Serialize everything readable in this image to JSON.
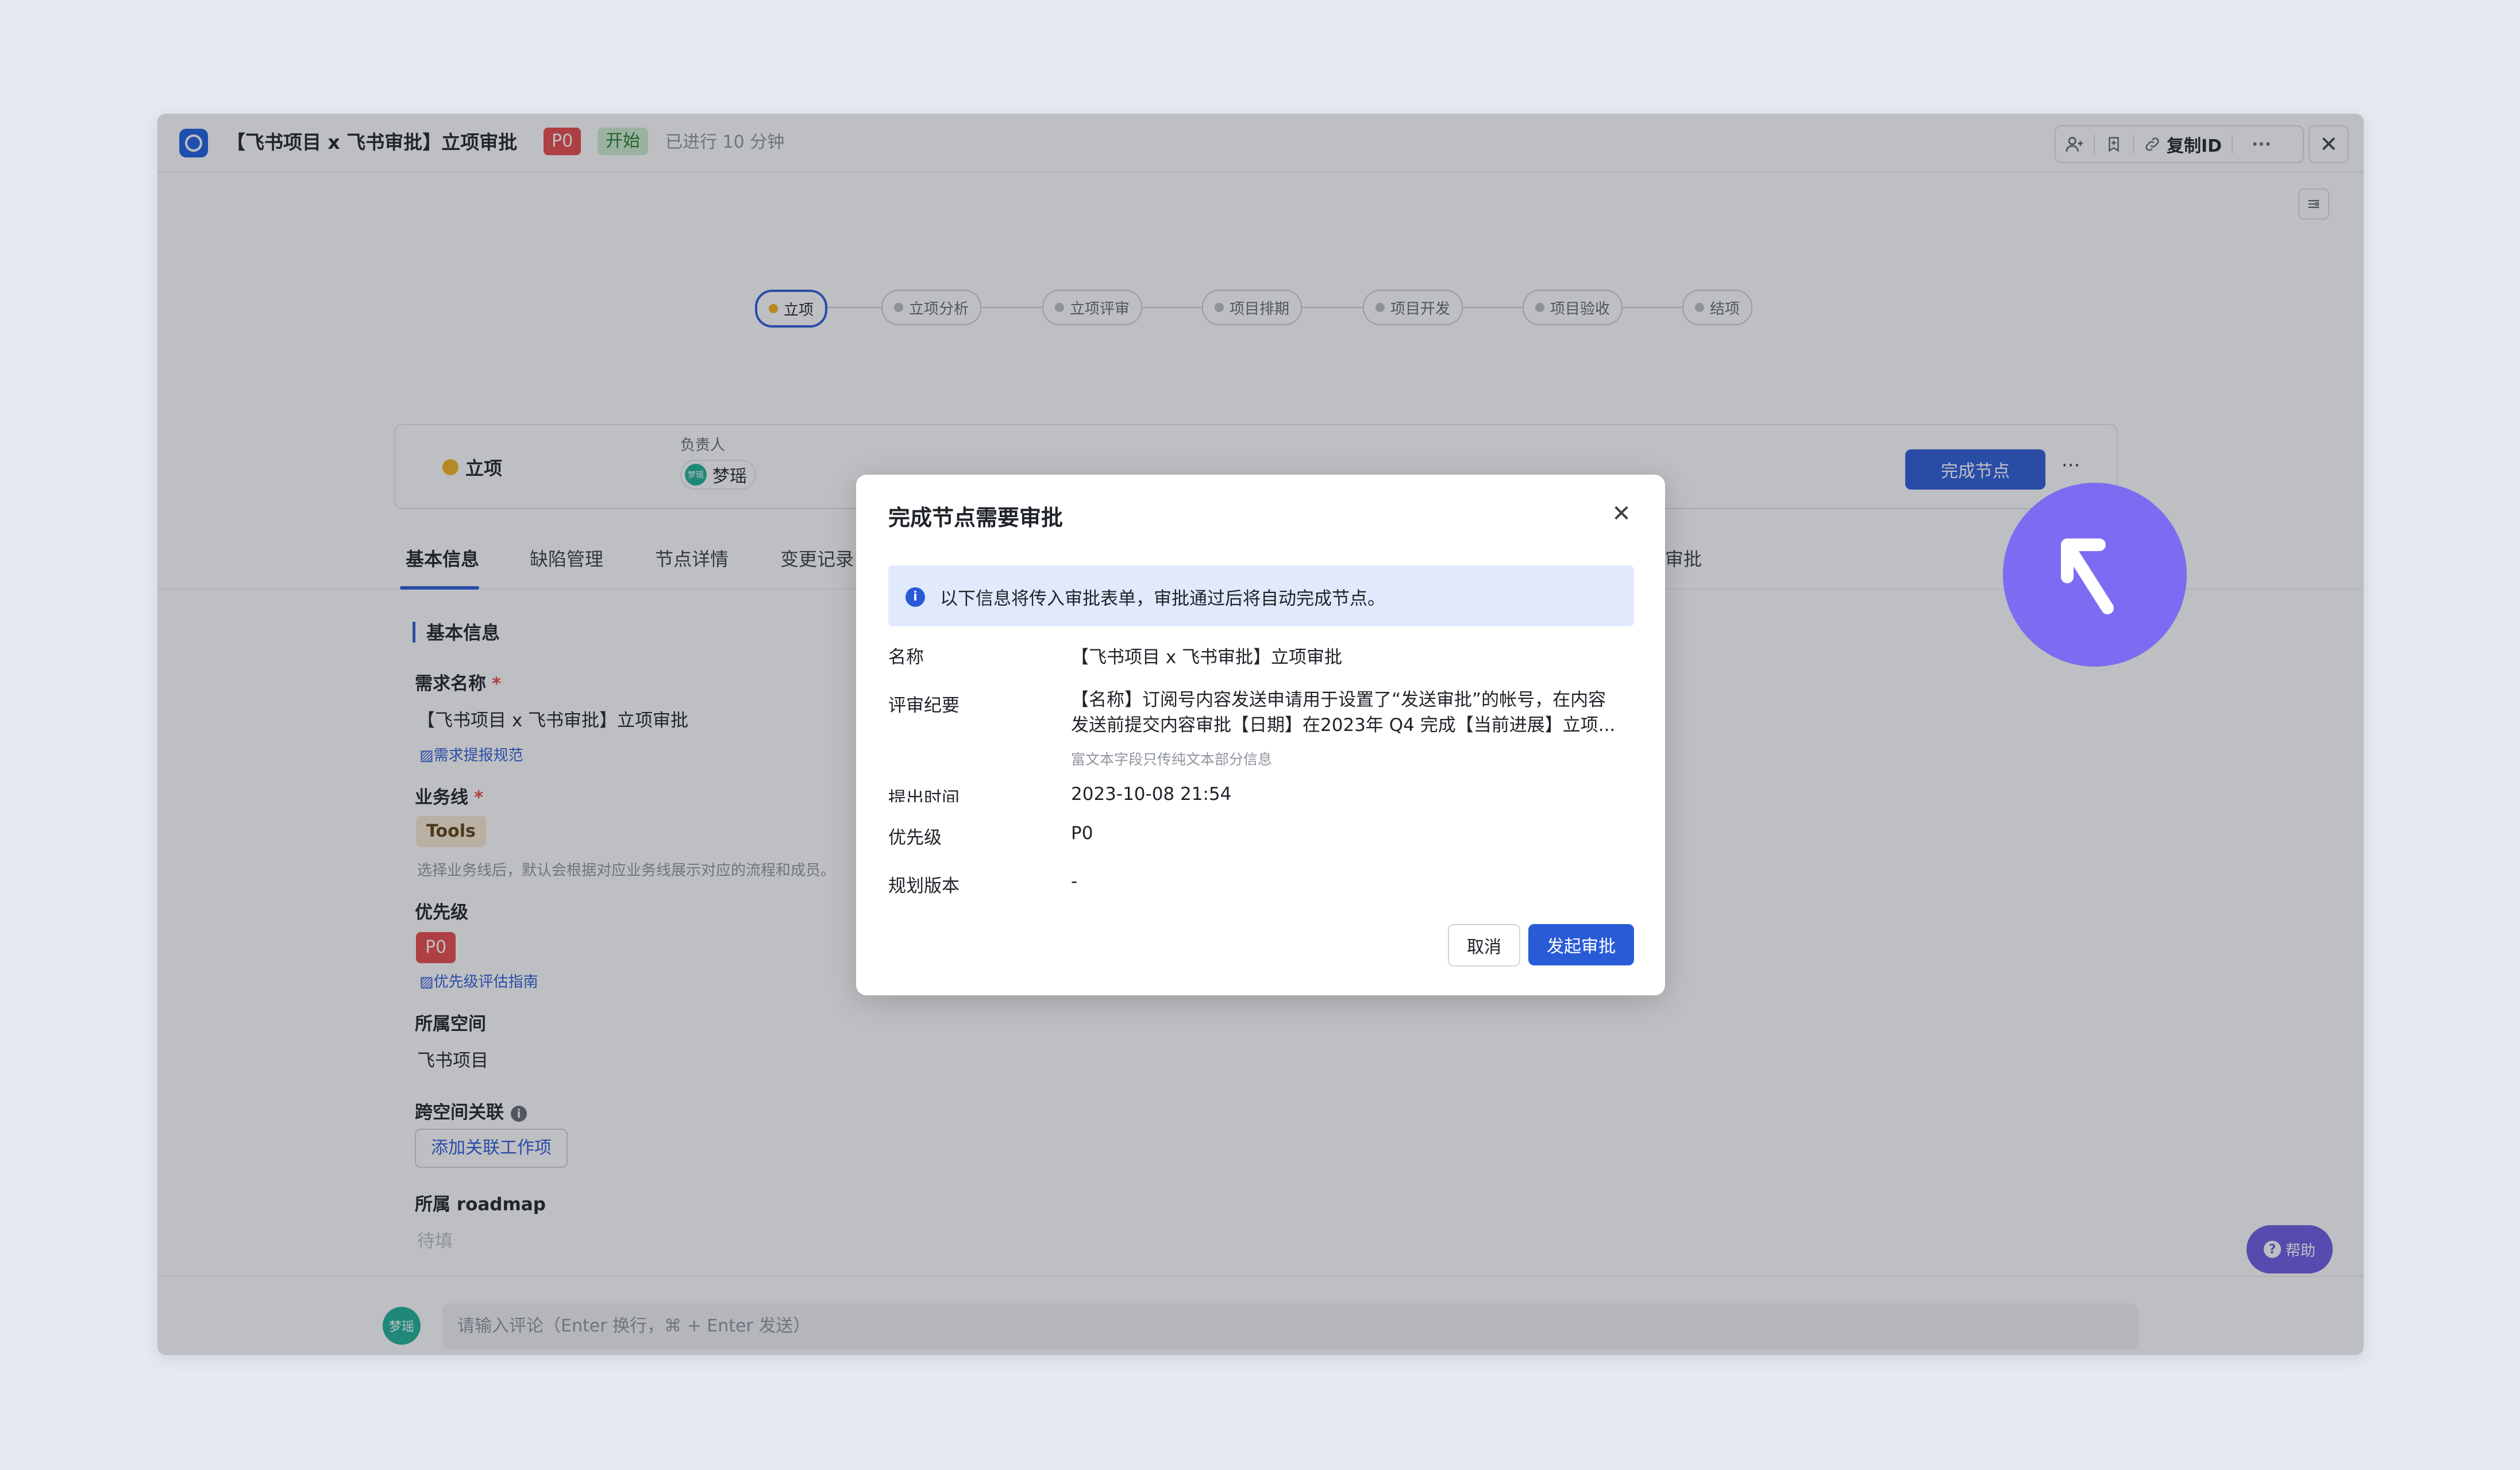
{
  "window": {
    "title": "【飞书项目 x 飞书审批】立项审批",
    "priority_tag": "P0",
    "status_tag": "开始",
    "elapsed": "已进行 10 分钟",
    "copy_id_label": "复制ID",
    "more_label": "···",
    "close_label": "✕"
  },
  "workflow": {
    "nodes": [
      "立项",
      "立项分析",
      "立项评审",
      "项目排期",
      "项目开发",
      "项目验收",
      "结项"
    ],
    "active_index": 0
  },
  "node_card": {
    "status_label": "立项",
    "owner_label": "负责人",
    "owner_name": "梦瑶",
    "owner_avatar_text": "梦瑶",
    "complete_button": "完成节点",
    "more_label": "···"
  },
  "tabs": [
    "基本信息",
    "缺陷管理",
    "节点详情",
    "变更记录",
    "审批"
  ],
  "basic_info": {
    "section_title": "基本信息",
    "req_name_label": "需求名称",
    "req_name_value": "【飞书项目 x 飞书审批】立项审批",
    "req_name_hint": "需求提报规范",
    "biz_line_label": "业务线",
    "biz_line_value": "Tools",
    "biz_line_hint": "选择业务线后，默认会根据对应业务线展示对应的流程和成员。",
    "priority_label": "优先级",
    "priority_value": "P0",
    "priority_hint": "优先级评估指南",
    "space_label": "所属空间",
    "space_value": "飞书项目",
    "cross_label": "跨空间关联",
    "add_link_button": "添加关联工作项",
    "roadmap_label": "所属 roadmap",
    "roadmap_value": "待填",
    "required_mark": "*"
  },
  "comment": {
    "avatar_text": "梦瑶",
    "placeholder": "请输入评论（Enter 换行，⌘ + Enter 发送）"
  },
  "help": {
    "label": "帮助"
  },
  "modal": {
    "title": "完成节点需要审批",
    "close": "✕",
    "banner": "以下信息将传入审批表单，审批通过后将自动完成节点。",
    "fields": {
      "name_label": "名称",
      "name_value": "【飞书项目 x 飞书审批】立项审批",
      "summary_label": "评审纪要",
      "summary_line1": "【名称】订阅号内容发送申请用于设置了“发送审批”的帐号，在内容",
      "summary_line2": "发送前提交内容审批【日期】在2023年 Q4 完成【当前进展】立项...",
      "summary_note": "富文本字段只传纯文本部分信息",
      "time_label": "提出时间",
      "time_value": "2023-10-08 21:54",
      "priority_label": "优先级",
      "priority_value": "P0",
      "version_label": "规划版本",
      "version_value": "-"
    },
    "cancel": "取消",
    "submit": "发起审批"
  },
  "colors": {
    "accent": "#2a5bd7",
    "danger": "#e8484a",
    "cursor": "#7b6cf2",
    "background": "#e4e9f2"
  },
  "icons": [
    "app-icon",
    "add-member-icon",
    "bookmark-icon",
    "link-icon",
    "more-icon",
    "close-icon",
    "settings-icon",
    "info-icon",
    "cursor-arrow-icon",
    "help-icon"
  ]
}
